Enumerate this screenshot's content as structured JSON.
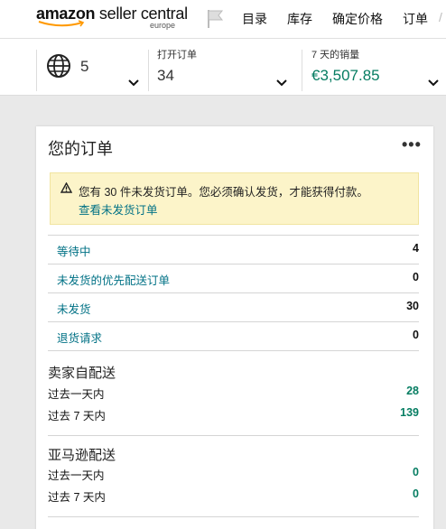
{
  "header": {
    "logo_brand": "amazon",
    "logo_product": "seller central",
    "logo_region": "europe",
    "nav": [
      "目录",
      "库存",
      "确定价格",
      "订单"
    ],
    "nav_cut": "/"
  },
  "metrics": {
    "marketplaces_count": "5",
    "open_orders_label": "打开订单",
    "open_orders_value": "34",
    "sales_label": "7 天的销量",
    "sales_value": "€3,507.85"
  },
  "orders_card": {
    "title": "您的订单",
    "more": "•••",
    "alert_text": "您有 30 件未发货订单。您必须确认发货，才能获得付款。",
    "alert_link": "查看未发货订单",
    "rows": [
      {
        "label": "等待中",
        "value": "4"
      },
      {
        "label": "未发货的优先配送订单",
        "value": "0"
      },
      {
        "label": "未发货",
        "value": "30"
      },
      {
        "label": "退货请求",
        "value": "0"
      }
    ],
    "sections": [
      {
        "title": "卖家自配送",
        "lines": [
          {
            "label": "过去一天内",
            "value": "28"
          },
          {
            "label": "过去 7 天内",
            "value": "139"
          }
        ]
      },
      {
        "title": "亚马逊配送",
        "lines": [
          {
            "label": "过去一天内",
            "value": "0"
          },
          {
            "label": "过去 7 天内",
            "value": "0"
          }
        ]
      }
    ]
  },
  "colors": {
    "link": "#007185",
    "value_green": "#067d62",
    "alert_bg": "#fcf4c9"
  }
}
